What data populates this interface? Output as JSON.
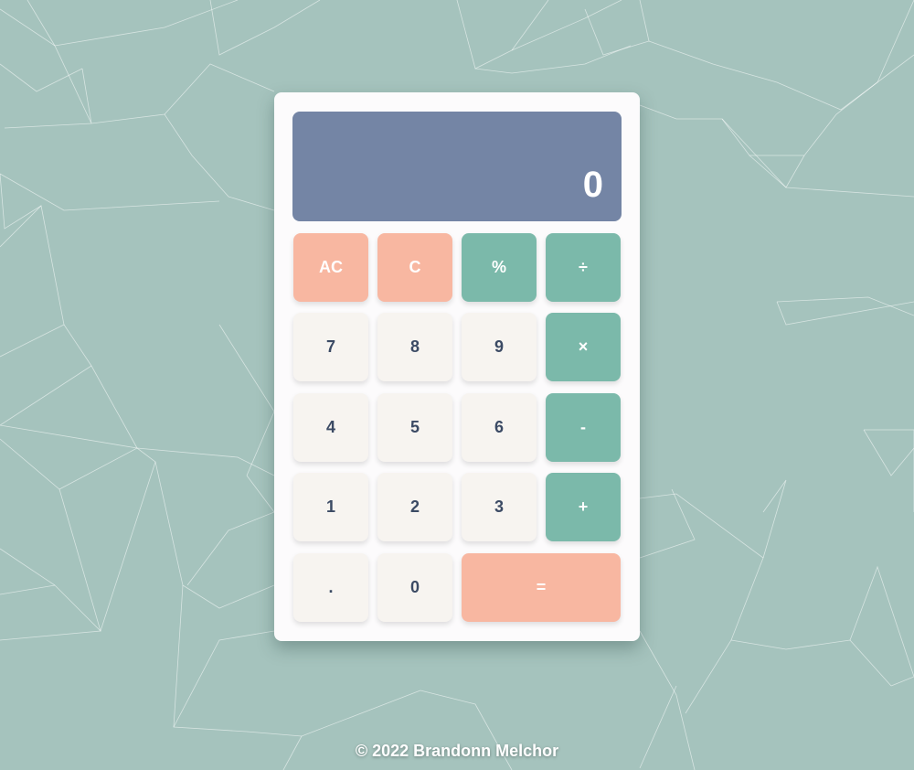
{
  "display": {
    "value": "0"
  },
  "keys": {
    "ac": "AC",
    "c": "C",
    "percent": "%",
    "divide": "÷",
    "seven": "7",
    "eight": "8",
    "nine": "9",
    "multiply": "×",
    "four": "4",
    "five": "5",
    "six": "6",
    "minus": "-",
    "one": "1",
    "two": "2",
    "three": "3",
    "plus": "+",
    "dot": ".",
    "zero": "0",
    "equals": "="
  },
  "footer": {
    "text": "© 2022 Brandonn Melchor"
  },
  "colors": {
    "background": "#a5c3bd",
    "display": "#7485a5",
    "number_key": "#f7f4f0",
    "pink_key": "#f8b7a1",
    "teal_key": "#7bb9aa",
    "number_text": "#3b4a64"
  }
}
